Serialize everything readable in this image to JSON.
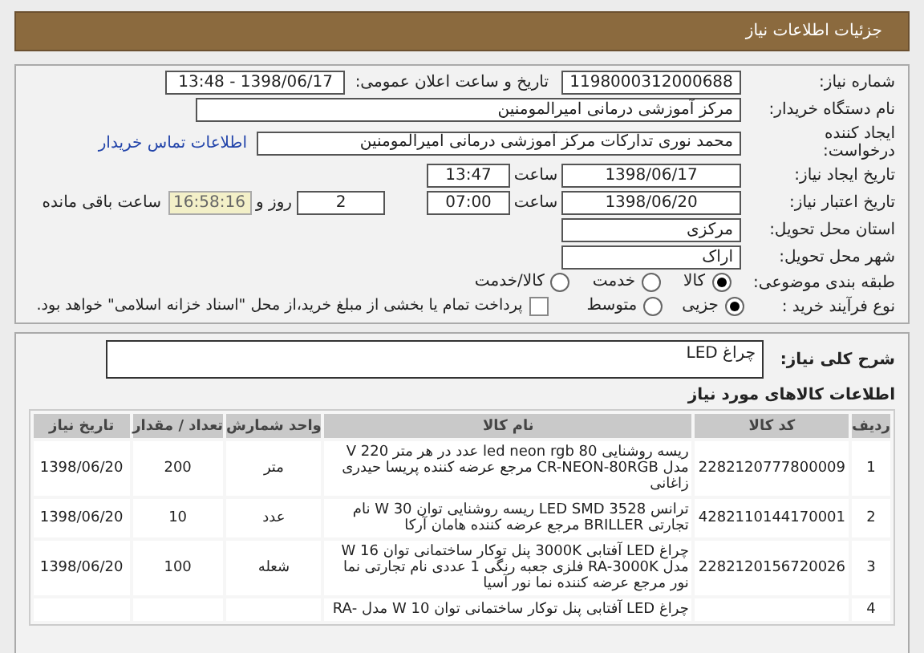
{
  "header": {
    "title": "جزئیات اطلاعات نیاز"
  },
  "need_number": {
    "label": "شماره نیاز:",
    "value": "1198000312000688"
  },
  "announce": {
    "label": "تاریخ و ساعت اعلان عمومی:",
    "value": "1398/06/17 - 13:48"
  },
  "buyer": {
    "label": "نام دستگاه خریدار:",
    "value": "مرکز آموزشی درمانی امیرالمومنین"
  },
  "creator": {
    "label": "ایجاد کننده درخواست:",
    "value": "محمد نوری تدارکات مرکز آموزشی درمانی امیرالمومنین",
    "link": "اطلاعات تماس خریدار"
  },
  "created": {
    "label": "تاریخ ایجاد نیاز:",
    "date": "1398/06/17",
    "time_label": "ساعت",
    "time": "13:47"
  },
  "deadline": {
    "label": "تاریخ اعتبار نیاز:",
    "date": "1398/06/20",
    "time_label": "ساعت",
    "time": "07:00",
    "days": "2",
    "days_label": "روز و",
    "remaining": "16:58:16",
    "remaining_label": "ساعت باقی مانده"
  },
  "province": {
    "label": "استان محل تحویل:",
    "value": "مرکزی"
  },
  "city": {
    "label": "شهر محل تحویل:",
    "value": "اراک"
  },
  "category": {
    "label": "طبقه بندی موضوعی:",
    "options": [
      {
        "label": "کالا",
        "selected": true
      },
      {
        "label": "خدمت",
        "selected": false
      },
      {
        "label": "کالا/خدمت",
        "selected": false
      }
    ]
  },
  "process": {
    "label": "نوع فرآیند خرید :",
    "options": [
      {
        "label": "جزیی",
        "selected": true
      },
      {
        "label": "متوسط",
        "selected": false
      }
    ],
    "payment": {
      "label": "پرداخت تمام یا بخشی از مبلغ خرید،از محل \"اسناد خزانه اسلامی\" خواهد بود.",
      "checked": false
    }
  },
  "summary": {
    "label": "شرح کلی نیاز:",
    "value": "چراغ LED"
  },
  "items": {
    "title": "اطلاعات کالاهای مورد نیاز",
    "columns": [
      "ردیف",
      "کد کالا",
      "نام کالا",
      "واحد شمارش",
      "تعداد / مقدار",
      "تاریخ نیاز"
    ],
    "rows": [
      {
        "row": "1",
        "code": "2282120777800009",
        "name": "ریسه روشنایی led neon rgb 80 عدد در هر متر V 220 مدل CR-NEON-80RGB مرجع عرضه کننده پریسا حیدری زاغانی",
        "unit": "متر",
        "qty": "200",
        "date": "1398/06/20"
      },
      {
        "row": "2",
        "code": "4282110144170001",
        "name": "ترانس LED SMD 3528 ریسه روشنایی توان W 30 نام تجارتی BRILLER مرجع عرضه کننده هامان آرکا",
        "unit": "عدد",
        "qty": "10",
        "date": "1398/06/20"
      },
      {
        "row": "3",
        "code": "2282120156720026",
        "name": "چراغ LED آفتابی 3000K پنل توکار ساختمانی توان W 16 مدل RA-3000K فلزی جعبه رنگی 1 عددی نام تجارتی نما نور مرجع عرضه کننده نما نور آسیا",
        "unit": "شعله",
        "qty": "100",
        "date": "1398/06/20"
      },
      {
        "row": "4",
        "code": "",
        "name": "چراغ LED آفتابی پنل توکار ساختمانی توان W 10 مدل -RA",
        "unit": "",
        "qty": "",
        "date": ""
      }
    ]
  }
}
